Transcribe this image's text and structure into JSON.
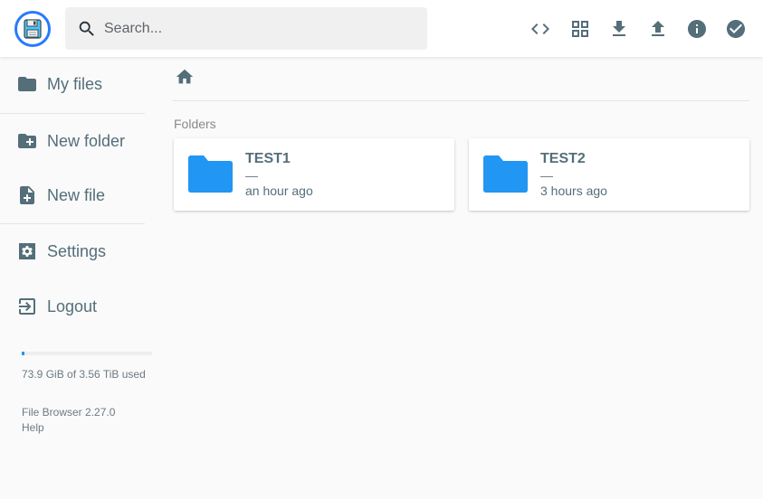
{
  "header": {
    "logo_icon": "floppy-disk-icon",
    "search": {
      "placeholder": "Search...",
      "value": ""
    },
    "actions": [
      {
        "icon": "code-icon"
      },
      {
        "icon": "grid-view-icon"
      },
      {
        "icon": "download-icon"
      },
      {
        "icon": "upload-icon"
      },
      {
        "icon": "info-icon"
      },
      {
        "icon": "select-check-icon"
      }
    ]
  },
  "sidebar": {
    "items": [
      {
        "label": "My files",
        "icon": "folder-icon"
      },
      {
        "label": "New folder",
        "icon": "create-new-folder-icon"
      },
      {
        "label": "New file",
        "icon": "note-add-icon"
      },
      {
        "label": "Settings",
        "icon": "settings-icon"
      },
      {
        "label": "Logout",
        "icon": "exit-icon"
      }
    ],
    "usage": {
      "text": "73.9 GiB of 3.56 TiB used",
      "fraction": 0.0203
    },
    "version": "File Browser 2.27.0",
    "help": "Help"
  },
  "main": {
    "section_title": "Folders",
    "folders": [
      {
        "name": "TEST1",
        "size": "—",
        "modified": "an hour ago"
      },
      {
        "name": "TEST2",
        "size": "—",
        "modified": "3 hours ago"
      }
    ]
  },
  "colors": {
    "accent": "#2196f3",
    "text": "#546e7a",
    "background": "#fafafa",
    "card": "#ffffff"
  }
}
